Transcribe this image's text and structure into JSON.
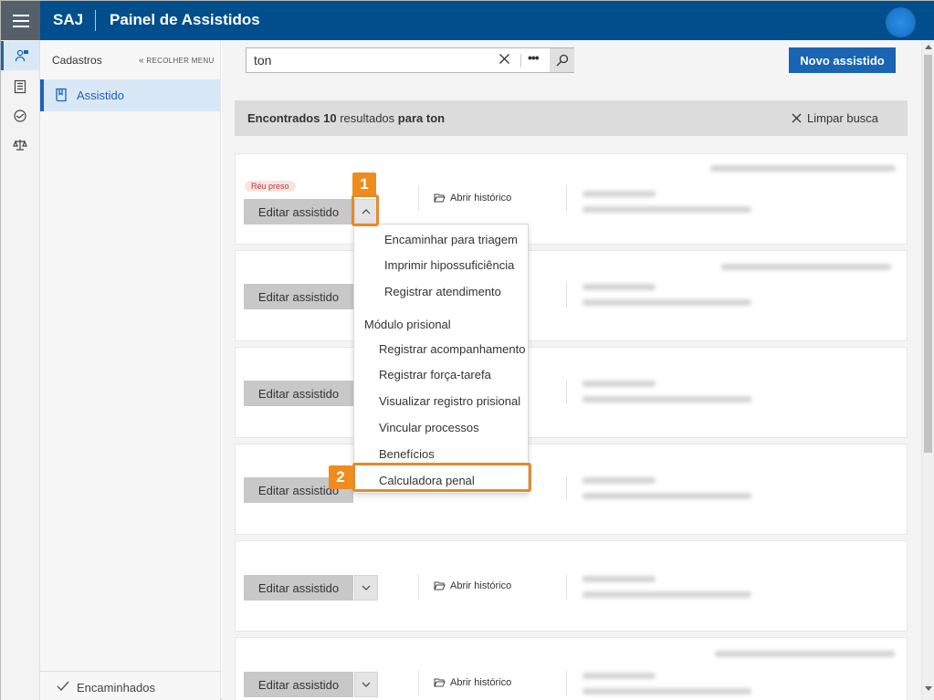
{
  "app": {
    "brand": "SAJ",
    "title": "Painel de Assistidos"
  },
  "iconbar": [
    {
      "icon": "person-list-icon",
      "active": true
    },
    {
      "icon": "ledger-icon",
      "active": false
    },
    {
      "icon": "handshake-icon",
      "active": false
    },
    {
      "icon": "scales-icon",
      "active": false
    }
  ],
  "sidebar": {
    "title": "Cadastros",
    "collapse_label": "RECOLHER MENU",
    "item_label": "Assistido",
    "bottom_label": "Encaminhados"
  },
  "search": {
    "value": "ton",
    "more": "•••"
  },
  "toolbar": {
    "new_label": "Novo assistido"
  },
  "results": {
    "prefix": "Encontrados",
    "count": "10",
    "middle": "resultados",
    "suffix": "para",
    "term": "ton",
    "clear_label": "Limpar busca"
  },
  "cards": {
    "badge": "Réu preso",
    "edit_label": "Editar assistido",
    "history_label": "Abrir histórico"
  },
  "dropdown": {
    "items": [
      "Encaminhar para triagem",
      "Imprimir hipossuficiência",
      "Registrar atendimento"
    ],
    "section": "Módulo prisional",
    "section_items": [
      "Registrar acompanhamento",
      "Registrar força-tarefa",
      "Visualizar registro prisional",
      "Vincular processos",
      "Benefícios",
      "Calculadora penal"
    ]
  },
  "callouts": [
    "1",
    "2"
  ],
  "colors": {
    "primary": "#004e8c",
    "button": "#1a64b4",
    "callout": "#f08c1e"
  }
}
